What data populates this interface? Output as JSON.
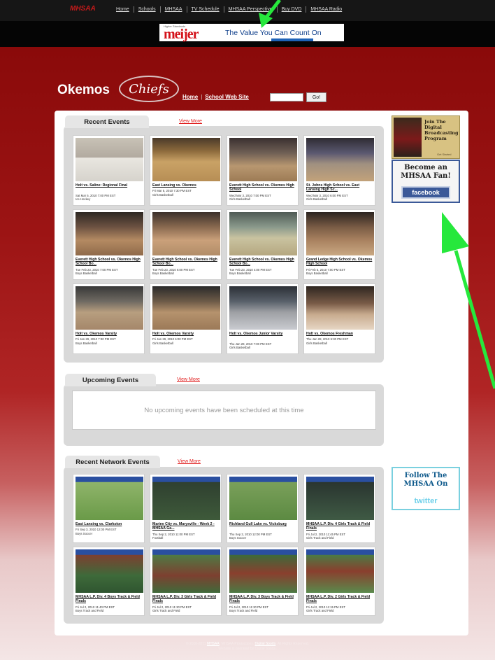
{
  "topbar": {
    "logo": "MHSAA",
    "nav": [
      "Home",
      "Schools",
      "MHSAA",
      "TV Schedule",
      "MHSAA Perspective",
      "Buy DVD",
      "MHSAA Radio"
    ]
  },
  "ad": {
    "tagline_small": "Higher Standards",
    "brand": "meijer",
    "text": "The Value You Can Count On"
  },
  "header": {
    "title": "Okemos",
    "logo_script": "Chiefs",
    "link_home": "Home",
    "link_school": "School Web Site",
    "search_value": "",
    "go_label": "Go!"
  },
  "recent": {
    "title": "Recent Events",
    "more": "View More",
    "items": [
      {
        "title": "Holt vs. Saline: Regional Final",
        "date": "Sat Mar 5, 2010 7:00 PM EST",
        "sport": "Ice Hockey"
      },
      {
        "title": "East Lansing vs. Okemos",
        "date": "Fri Mar 5, 2010 7:30 PM EST",
        "sport": "Girls Basketball"
      },
      {
        "title": "Everett High School vs. Okemos High School",
        "date": "Wed Mar 3, 2010 7:00 PM EST",
        "sport": "Girls Basketball"
      },
      {
        "title": "St. Johns High School vs. East Lansing High Sc...",
        "date": "Wed Mar 3, 2010 6:00 PM EST",
        "sport": "Girls Basketball"
      },
      {
        "title": "Everett High School vs. Okemos High School Bo...",
        "date": "Tue Feb 23, 2010 7:00 PM EST",
        "sport": "Boys Basketball"
      },
      {
        "title": "Everett High School vs. Okemos High School Bo...",
        "date": "Tue Feb 23, 2010 6:00 PM EST",
        "sport": "Boys Basketball"
      },
      {
        "title": "Everett High School vs. Okemos High School Bo...",
        "date": "Tue Feb 23, 2010 4:00 PM EST",
        "sport": "Boys Basketball"
      },
      {
        "title": "Grand Ledge High School vs. Okemos High School",
        "date": "Fri Feb 5, 2010 7:00 PM EST",
        "sport": "Boys Basketball"
      },
      {
        "title": "Holt vs. Okemos Varsity",
        "date": "Fri Jan 29, 2010 7:30 PM EST",
        "sport": "Boys Basketball"
      },
      {
        "title": "Holt vs. Okemos Varsity",
        "date": "Fri Jan 29, 2010 6:00 PM EST",
        "sport": "Girls Basketball"
      },
      {
        "title": "Holt vs. Okemos Junior Varsity",
        "date": "Thu Jan 28, 2010 7:00 PM EST",
        "sport": "Girls Basketball"
      },
      {
        "title": "Holt vs. Okemos Freshman",
        "date": "Thu Jan 28, 2010 5:30 PM EST",
        "sport": "Girls Basketball"
      }
    ]
  },
  "upcoming": {
    "title": "Upcoming Events",
    "more": "View More",
    "empty": "No upcoming events have been scheduled at this time"
  },
  "network": {
    "title": "Recent Network Events",
    "more": "View More",
    "items": [
      {
        "title": "East Lansing vs. Clarkston",
        "date": "Fri Sep 3, 2010 12:00 PM EST",
        "sport": "Boys Soccer"
      },
      {
        "title": "Marine City vs. Marysville - Week 2 - MHSAA Ga...",
        "date": "Thu Sep 2, 2010 11:00 PM EST",
        "sport": "Football"
      },
      {
        "title": "Richland Gull Lake vs. Vicksburg",
        "date": "Thu Sep 2, 2010 12:00 PM EST",
        "sport": "Boys Soccer"
      },
      {
        "title": "MHSAA L.P. Div. 4 Girls Track & Field Finals",
        "date": "Fri Jul 2, 2010 11:45 PM EST",
        "sport": "Girls Track and Field"
      },
      {
        "title": "MHSAA L.P. Div. 4 Boys Track & Field Finals",
        "date": "Fri Jul 2, 2010 11:40 PM EST",
        "sport": "Boys Track and Field"
      },
      {
        "title": "MHSAA L.P. Div. 3 Girls Track & Field Finals",
        "date": "Fri Jul 2, 2010 11:30 PM EST",
        "sport": "Girls Track and Field"
      },
      {
        "title": "MHSAA L.P. Div. 3 Boys Track & Field Finals",
        "date": "Fri Jul 2, 2010 11:30 PM EST",
        "sport": "Boys Track and Field"
      },
      {
        "title": "MHSAA L.P. Div. 2 Girls Track & Field Finals",
        "date": "Fri Jul 2, 2010 11:15 PM EST",
        "sport": "Girls Track and Field"
      }
    ]
  },
  "rail": {
    "digital": "Join The Digital Broadcasting Program",
    "digital_sub": "Get Started",
    "fan_text": "Become an MHSAA Fan!",
    "facebook": "facebook",
    "follow_text": "Follow The MHSAA On",
    "twitter": "twitter"
  },
  "footer": {
    "line1_pre": "© 2010-2011 ",
    "line1_link1": "MHSAA",
    "line1_mid": ". MHSAA Productions. ",
    "line1_link2": "Digital Sports",
    "line1_post": ". All Rights Reserved.",
    "line2": "Website is operated by Digital Sports."
  },
  "colors": {
    "header_black": "#0a0a0a",
    "brand_red": "#9c1414",
    "link_red": "#e01b1b",
    "facebook_blue": "#3b5998",
    "annotation_green": "#26e83c"
  }
}
